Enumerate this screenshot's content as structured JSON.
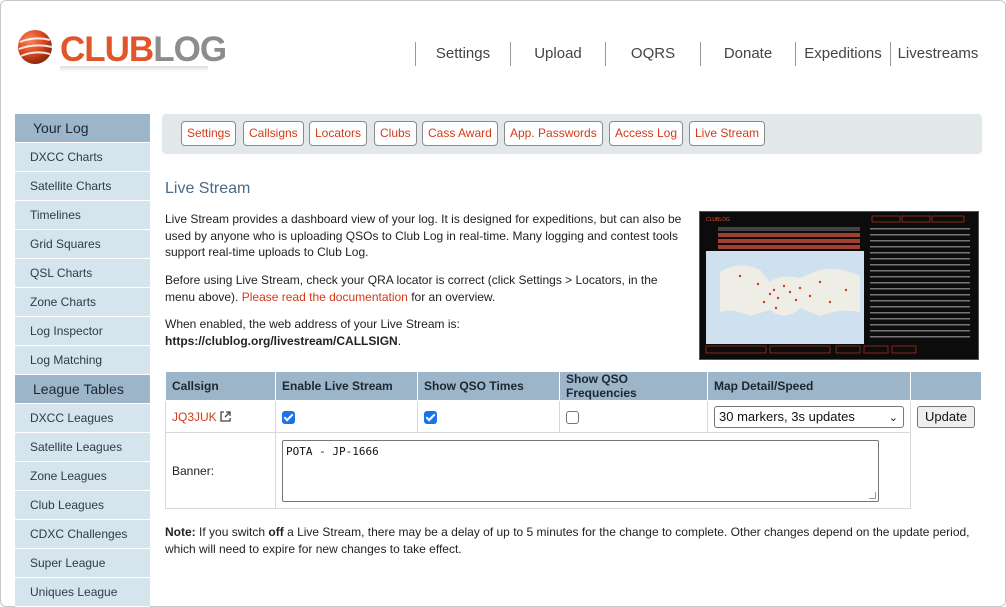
{
  "brand": {
    "club": "CLUB",
    "log": "LOG"
  },
  "topnav": [
    "Settings",
    "Upload",
    "OQRS",
    "Donate",
    "Expeditions",
    "Livestreams"
  ],
  "sidebar": {
    "your_log": {
      "heading": "Your Log",
      "items": [
        "DXCC Charts",
        "Satellite Charts",
        "Timelines",
        "Grid Squares",
        "QSL Charts",
        "Zone Charts",
        "Log Inspector",
        "Log Matching"
      ]
    },
    "league": {
      "heading": "League Tables",
      "items": [
        "DXCC Leagues",
        "Satellite Leagues",
        "Zone Leagues",
        "Club Leagues",
        "CDXC Challenges",
        "Super League",
        "Uniques League"
      ]
    }
  },
  "subtabs": [
    "Settings",
    "Callsigns",
    "Locators",
    "Clubs",
    "Cass Award",
    "App. Passwords",
    "Access Log",
    "Live Stream"
  ],
  "content": {
    "title": "Live Stream",
    "intro": "Live Stream provides a dashboard view of your log. It is designed for expeditions, but can also be used by anyone who is uploading QSOs to Club Log in real-time. Many logging and contest tools support real-time uploads to Club Log.",
    "before_text": "Before using Live Stream, check your QRA locator is correct (click Settings > Locators, in the menu above).",
    "doc_link": "Please read the documentation",
    "doc_suffix": "for an overview.",
    "enabled_text": "When enabled, the web address of your Live Stream is:",
    "stream_url": "https://clublog.org/livestream/CALLSIGN",
    "note_label": "Note:",
    "note_part1": "If you switch",
    "note_off": "off",
    "note_part2": "a Live Stream, there may be a delay of up to 5 minutes for the change to complete. Other changes depend on the update period, which will need to expire for new changes to take effect."
  },
  "table": {
    "headers": [
      "Callsign",
      "Enable Live Stream",
      "Show QSO Times",
      "Show QSO Frequencies",
      "Map Detail/Speed"
    ],
    "row": {
      "callsign": "JQ3JUK",
      "enable_live_stream": true,
      "show_qso_times": true,
      "show_qso_frequencies": false,
      "map_detail": "30 markers, 3s updates",
      "update_label": "Update"
    },
    "banner_label": "Banner:",
    "banner_value": "POTA - JP-1666"
  },
  "colors": {
    "accent": "#d33a18",
    "header_blue": "#9db5c8",
    "sidebar_bg": "#d6e4ee",
    "title_blue": "#4a6a86"
  }
}
